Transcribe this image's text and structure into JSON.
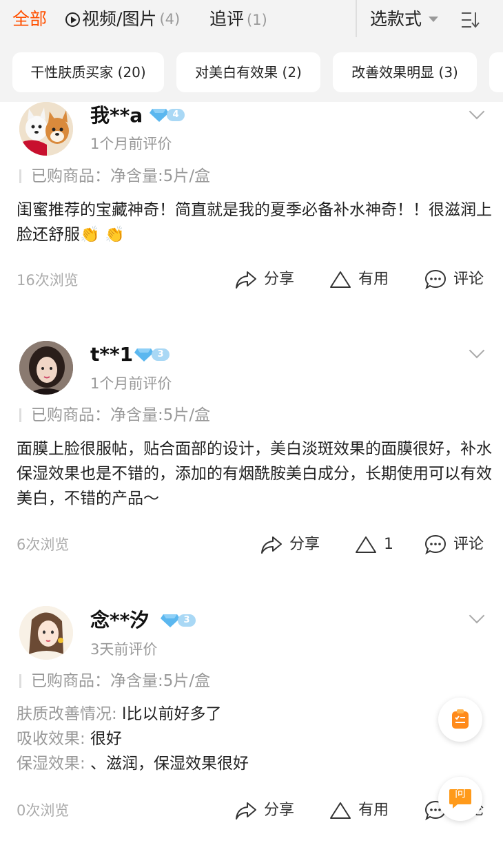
{
  "tabs": {
    "all": "全部",
    "video_label": "视频/图片",
    "video_count": "(4)",
    "follow_label": "追评",
    "follow_count": "(1)",
    "style_select": "选款式"
  },
  "chips": [
    "干性肤质买家 (20)",
    "对美白有效果 (2)",
    "改善效果明显 (3)"
  ],
  "actions": {
    "share": "分享",
    "useful": "有用",
    "comment": "评论"
  },
  "colors": {
    "accent": "#ff5000",
    "badge": "#a9d8f5"
  },
  "reviews": [
    {
      "user": "我**a",
      "level": "4",
      "time": "1个月前评价",
      "purchased": "已购商品：净含量:5片/盒",
      "text": "闺蜜推荐的宝藏神奇！简直就是我的夏季必备补水神奇！！很滋润上脸还舒服👏 👏",
      "views": "16次浏览",
      "useful_label": "有用"
    },
    {
      "user": "t**1",
      "level": "3",
      "time": "1个月前评价",
      "purchased": "已购商品：净含量:5片/盒",
      "text": "面膜上脸很服帖，贴合面部的设计，美白淡斑效果的面膜很好，补水保湿效果也是不错的，添加的有烟酰胺美白成分，长期使用可以有效美白，不错的产品～",
      "views": "6次浏览",
      "useful_label": "1"
    },
    {
      "user": "念**汐",
      "level": "3",
      "time": "3天前评价",
      "purchased": "已购商品：净含量:5片/盒",
      "fields": [
        {
          "label": "肤质改善情况:",
          "value": " l比以前好多了"
        },
        {
          "label": "吸收效果:",
          "value": " 很好"
        },
        {
          "label": "保湿效果:",
          "value": " 、滋润，保湿效果很好"
        }
      ],
      "views": "0次浏览",
      "useful_label": "有用"
    }
  ],
  "float_ask_label": "问"
}
